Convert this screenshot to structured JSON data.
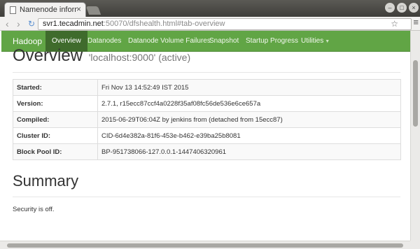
{
  "browser": {
    "tab_title": "Namenode informat",
    "tab_close": "×",
    "url_host": "svr1.tecadmin.net",
    "url_rest": ":50070/dfshealth.html#tab-overview",
    "back_icon": "‹",
    "forward_icon": "›",
    "reload_icon": "↻",
    "star_icon": "☆",
    "menu_icon": "≡",
    "minimize_icon": "–",
    "maximize_icon": "□",
    "close_icon": "×"
  },
  "navbar": {
    "brand": "Hadoop",
    "items": [
      {
        "label": "Overview",
        "active": true
      },
      {
        "label": "Datanodes",
        "active": false
      },
      {
        "label": "Datanode Volume Failures",
        "active": false
      },
      {
        "label": "Snapshot",
        "active": false
      },
      {
        "label": "Startup Progress",
        "active": false
      },
      {
        "label": "Utilities",
        "active": false
      }
    ],
    "dropdown_caret": "▼"
  },
  "overview": {
    "title": "Overview",
    "subtitle": "'localhost:9000' (active)",
    "rows": [
      {
        "key": "Started:",
        "value": "Fri Nov 13 14:52:49 IST 2015"
      },
      {
        "key": "Version:",
        "value": "2.7.1, r15ecc87ccf4a0228f35af08fc56de536e6ce657a"
      },
      {
        "key": "Compiled:",
        "value": "2015-06-29T06:04Z by jenkins from (detached from 15ecc87)"
      },
      {
        "key": "Cluster ID:",
        "value": "CID-6d4e382a-81f6-453e-b462-e39ba25b8081"
      },
      {
        "key": "Block Pool ID:",
        "value": "BP-951738066-127.0.0.1-1447406320961"
      }
    ]
  },
  "summary": {
    "title": "Summary",
    "security_text": "Security is off."
  },
  "colors": {
    "navbar_green": "#61a545",
    "active_tab": "#3f6b2c"
  }
}
